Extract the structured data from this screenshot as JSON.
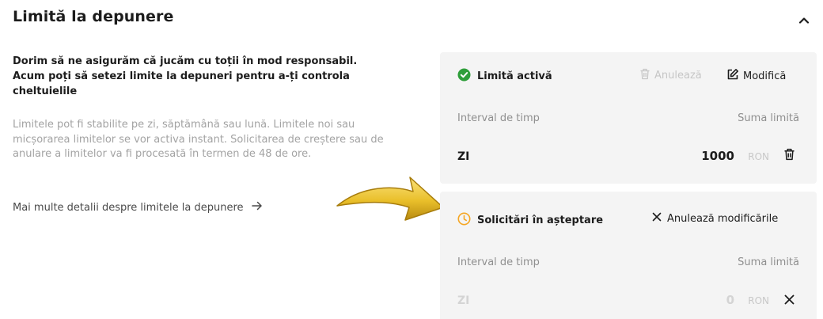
{
  "section": {
    "title": "Limită la depunere"
  },
  "intro": {
    "headline": "Dorim să ne asigurăm că jucăm cu toții în mod responsabil. Acum poți să setezi limite la depuneri pentru a-ți controla cheltuielile",
    "description": "Limitele pot fi stabilite pe zi, săptămână sau lună. Limitele noi sau micșorarea limitelor se vor activa instant. Solicitarea de creștere sau de anulare a limitelor va fi procesată în termen de 48 de ore.",
    "more_link": "Mai multe detalii despre limitele la depunere"
  },
  "active_card": {
    "status": "Limită activă",
    "cancel_label": "Anulează",
    "modify_label": "Modifică",
    "col_period": "Interval de timp",
    "col_amount": "Suma limită",
    "row": {
      "period": "ZI",
      "amount": "1000",
      "currency": "RON"
    }
  },
  "pending_card": {
    "status": "Solicitări în așteptare",
    "cancel_changes_label": "Anulează modificările",
    "col_period": "Interval de timp",
    "col_amount": "Suma limită",
    "row": {
      "period": "ZI",
      "amount": "0",
      "currency": "RON"
    }
  },
  "icons": {
    "collapse": "chevron-up-icon",
    "active_status": "check-circle-icon",
    "pending_status": "clock-icon",
    "cancel": "trash-icon",
    "modify": "edit-icon",
    "cancel_changes": "close-icon",
    "more_link": "arrow-right-icon",
    "row_delete": "trash-icon",
    "row_remove": "close-icon"
  },
  "colors": {
    "active_green": "#2e9e3a",
    "pending_orange": "#f5a623",
    "card_bg": "#f4f4f4",
    "arrow_gold": "#e9bf2a"
  }
}
